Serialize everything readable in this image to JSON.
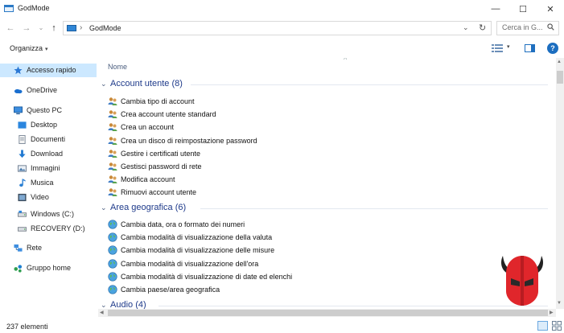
{
  "window": {
    "title": "GodMode",
    "minimize_glyph": "—",
    "maximize_glyph": "☐",
    "close_glyph": "✕"
  },
  "navigation": {
    "back_glyph": "←",
    "forward_glyph": "→",
    "history_glyph": "⌄",
    "up_glyph": "↑"
  },
  "address_bar": {
    "separator": "›",
    "breadcrumb": "GodMode",
    "dropdown_glyph": "⌄",
    "refresh_glyph": "↻"
  },
  "search": {
    "placeholder": "Cerca in G..."
  },
  "toolbar": {
    "organize_label": "Organizza",
    "organize_caret": "▾",
    "view_caret": "▾",
    "help_label": "?"
  },
  "sidebar": {
    "items": [
      {
        "label": "Accesso rapido",
        "icon": "star-icon"
      },
      {
        "label": "OneDrive",
        "icon": "cloud-icon"
      },
      {
        "label": "Questo PC",
        "icon": "computer-icon"
      },
      {
        "label": "Desktop",
        "icon": "desktop-icon"
      },
      {
        "label": "Documenti",
        "icon": "documents-icon"
      },
      {
        "label": "Download",
        "icon": "download-icon"
      },
      {
        "label": "Immagini",
        "icon": "pictures-icon"
      },
      {
        "label": "Musica",
        "icon": "music-icon"
      },
      {
        "label": "Video",
        "icon": "video-icon"
      },
      {
        "label": "Windows (C:)",
        "icon": "drive-icon"
      },
      {
        "label": "RECOVERY (D:)",
        "icon": "drive-icon"
      },
      {
        "label": "Rete",
        "icon": "network-icon"
      },
      {
        "label": "Gruppo home",
        "icon": "homegroup-icon"
      }
    ]
  },
  "content": {
    "column_header": "Nome",
    "sort_glyph": "^",
    "groups": [
      {
        "title": "Account utente (8)",
        "icon": "user-accounts-icon",
        "items": [
          "Cambia tipo di account",
          "Crea account utente standard",
          "Crea un account",
          "Crea un disco di reimpostazione password",
          "Gestire i certificati utente",
          "Gestisci password di rete",
          "Modifica account",
          "Rimuovi account utente"
        ]
      },
      {
        "title": "Area geografica (6)",
        "icon": "region-globe-icon",
        "items": [
          "Cambia data, ora o formato dei numeri",
          "Cambia modalità di visualizzazione della valuta",
          "Cambia modalità di visualizzazione delle misure",
          "Cambia modalità di visualizzazione dell'ora",
          "Cambia modalità di visualizzazione di date ed elenchi",
          "Cambia paese/area geografica"
        ]
      },
      {
        "title": "Audio (4)",
        "icon": "audio-icon",
        "items": []
      }
    ]
  },
  "scrollbars": {
    "up_glyph": "▲",
    "down_glyph": "▼",
    "left_glyph": "◀",
    "right_glyph": "▶"
  },
  "status": {
    "item_count": "237 elementi"
  },
  "colors": {
    "selection": "#cce8ff",
    "group_title": "#1e3a8a",
    "accent": "#1c6ec0",
    "logo_red": "#e0262b"
  }
}
